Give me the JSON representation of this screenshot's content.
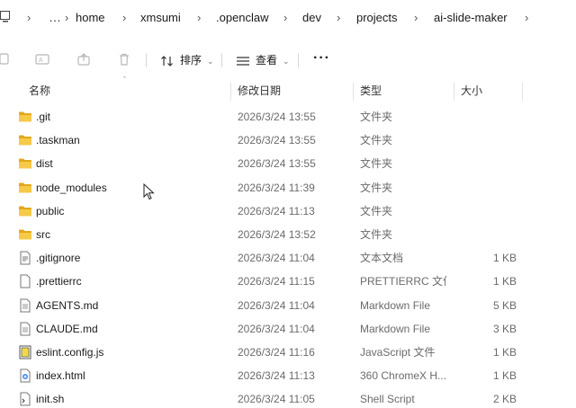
{
  "breadcrumb": {
    "overflow": "…",
    "items": [
      "home",
      "xmsumi",
      ".openclaw",
      "dev",
      "projects",
      "ai-slide-maker"
    ],
    "separator": "›"
  },
  "toolbar": {
    "sort_label": "排序",
    "view_label": "查看",
    "more_label": "···",
    "icons": [
      "copy-icon",
      "rename-icon",
      "share-icon",
      "delete-icon"
    ]
  },
  "columns": {
    "name": "名称",
    "date": "修改日期",
    "type": "类型",
    "size": "大小"
  },
  "files": [
    {
      "name": ".git",
      "date": "2026/3/24 13:55",
      "type": "文件夹",
      "size": "",
      "icon": "folder-icon"
    },
    {
      "name": ".taskman",
      "date": "2026/3/24 13:55",
      "type": "文件夹",
      "size": "",
      "icon": "folder-icon"
    },
    {
      "name": "dist",
      "date": "2026/3/24 13:55",
      "type": "文件夹",
      "size": "",
      "icon": "folder-icon"
    },
    {
      "name": "node_modules",
      "date": "2026/3/24 11:39",
      "type": "文件夹",
      "size": "",
      "icon": "folder-icon"
    },
    {
      "name": "public",
      "date": "2026/3/24 11:13",
      "type": "文件夹",
      "size": "",
      "icon": "folder-icon"
    },
    {
      "name": "src",
      "date": "2026/3/24 13:52",
      "type": "文件夹",
      "size": "",
      "icon": "folder-icon"
    },
    {
      "name": ".gitignore",
      "date": "2026/3/24 11:04",
      "type": "文本文档",
      "size": "1 KB",
      "icon": "text-file-icon"
    },
    {
      "name": ".prettierrc",
      "date": "2026/3/24 11:15",
      "type": "PRETTIERRC 文件",
      "size": "1 KB",
      "icon": "generic-file-icon"
    },
    {
      "name": "AGENTS.md",
      "date": "2026/3/24 11:04",
      "type": "Markdown File",
      "size": "5 KB",
      "icon": "markdown-file-icon"
    },
    {
      "name": "CLAUDE.md",
      "date": "2026/3/24 11:04",
      "type": "Markdown File",
      "size": "3 KB",
      "icon": "markdown-file-icon"
    },
    {
      "name": "eslint.config.js",
      "date": "2026/3/24 11:16",
      "type": "JavaScript 文件",
      "size": "1 KB",
      "icon": "javascript-file-icon"
    },
    {
      "name": "index.html",
      "date": "2026/3/24 11:13",
      "type": "360 ChromeX H...",
      "size": "1 KB",
      "icon": "html-file-icon"
    },
    {
      "name": "init.sh",
      "date": "2026/3/24 11:05",
      "type": "Shell Script",
      "size": "2 KB",
      "icon": "shell-file-icon"
    }
  ],
  "colors": {
    "folder": "#f7c948",
    "folder_dark": "#e3a71b",
    "muted_text": "#6b6b6b"
  }
}
